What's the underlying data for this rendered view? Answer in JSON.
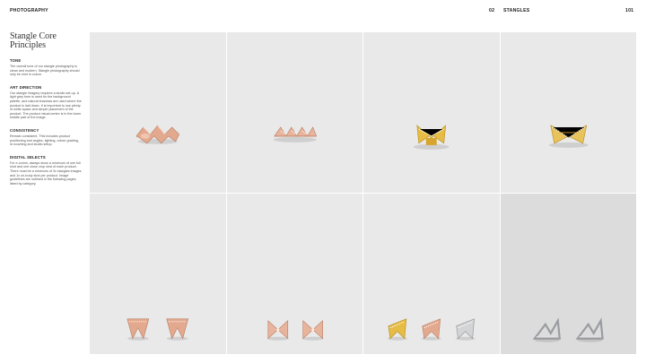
{
  "header": {
    "left_section": "PHOTOGRAPHY",
    "left_page": "02",
    "right_section": "STANGLES",
    "right_page": "101"
  },
  "sidebar": {
    "title_line1": "Stangle Core",
    "title_line2": "Principles",
    "sections": [
      {
        "heading": "TONE",
        "body": "The overall tone of our stangle photography is clean and modern. Stangle photography should only be shot in colour."
      },
      {
        "heading": "ART DIRECTION",
        "body": "Our stangle imagery requires a studio set-up. A light grey tone is used for the background palette, and natural shadows are used where the product is laid down. It is important to use plenty of white space and simple placement of the product. The product visual centre is in the lower middle part of the image."
      },
      {
        "heading": "CONSISTENCY",
        "body": "Remain consistent. This includes product positioning and angles, lighting, colour grading, re-touching and studio setup."
      },
      {
        "heading": "DIGITAL SELECTS",
        "body": "For e-comm, always show a minimum of one full shot and one close crop shot of each product. There must be a minimum of 3x stangles images and 1x on-body shot per product. Image guidelines are outlined in the following pages, listed by category."
      }
    ]
  },
  "photos": [
    {
      "name": "rose-gold-crossover-ring"
    },
    {
      "name": "rose-gold-pave-band-ring"
    },
    {
      "name": "yellow-gold-stangle-ring"
    },
    {
      "name": "yellow-gold-pave-stangle-ring"
    },
    {
      "name": "rose-gold-triangle-studs"
    },
    {
      "name": "rose-gold-bowtie-studs"
    },
    {
      "name": "mixed-metal-stud-trio"
    },
    {
      "name": "silver-stangle-earrings"
    }
  ],
  "colors": {
    "rose_gold": "#e3a98e",
    "yellow_gold": "#e7bc45",
    "silver": "#d3d4d6",
    "background": "#e9e9e9"
  }
}
